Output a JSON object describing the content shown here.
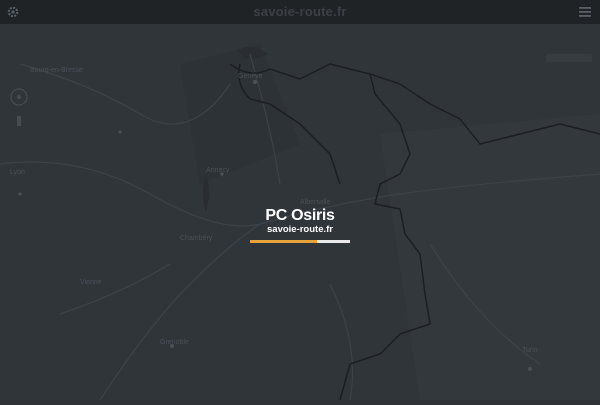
{
  "header": {
    "title": "savoie-route.fr",
    "settings_icon": "gear-icon",
    "menu_icon": "hamburger-menu-icon"
  },
  "loader": {
    "title": "PC Osiris",
    "subtitle": "savoie-route.fr",
    "progress": 0.67,
    "progress_color": "#e7a23a",
    "track_color": "#e9e9e9"
  },
  "map": {
    "labels": [
      "Genève",
      "Annecy",
      "Chambéry",
      "Grenoble",
      "Turin",
      "Albertville",
      "Bourg-en-Bresse",
      "Lyon",
      "Vienne"
    ]
  },
  "colors": {
    "background": "#2f3338",
    "header": "#1f2326"
  }
}
